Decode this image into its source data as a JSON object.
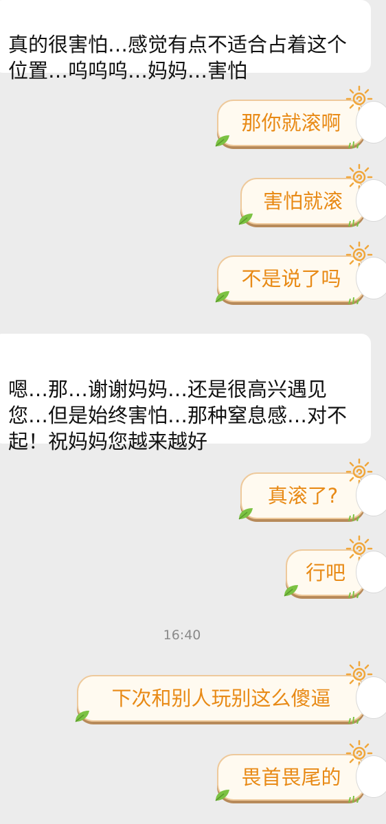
{
  "incoming": [
    "真的很害怕…感觉有点不适合占着这个位置…呜呜呜…妈妈…害怕",
    "嗯…那…谢谢妈妈…还是很高兴遇见您…但是始终害怕…那种窒息感…对不起！祝妈妈您越来越好"
  ],
  "outgoing": [
    "那你就滚啊",
    "害怕就滚",
    "不是说了吗",
    "真滚了?",
    "行吧",
    "下次和别人玩别这么傻逼",
    "畏首畏尾的"
  ],
  "timestamp": "16:40",
  "colors": {
    "background": "#ececec",
    "incoming_bubble": "#ffffff",
    "outgoing_text": "#e88a16",
    "outgoing_border": "#eec99b",
    "sun": "#f0a63a",
    "leaf": "#7cc243"
  },
  "icons": [
    "sun-icon",
    "leaf-icon"
  ]
}
